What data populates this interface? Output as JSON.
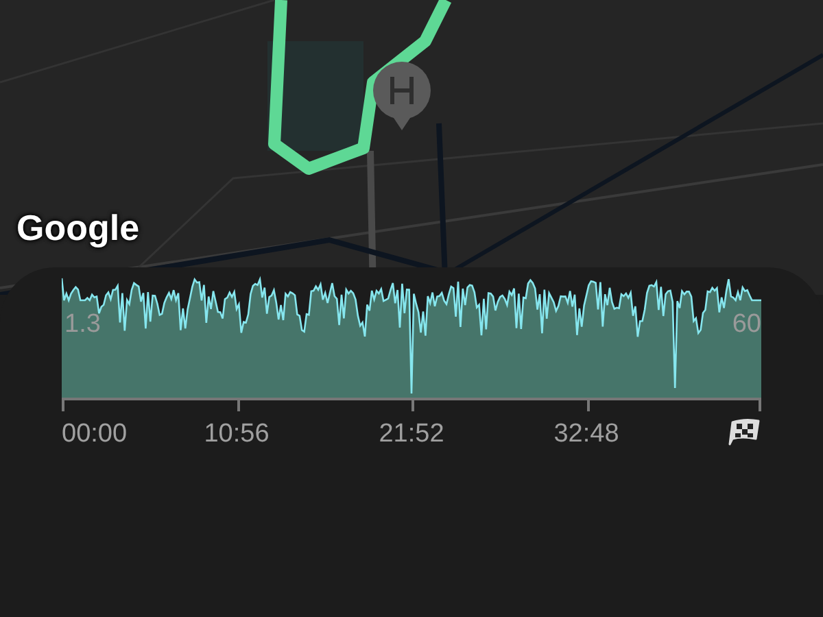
{
  "map": {
    "attribution": "Google"
  },
  "chart": {
    "left_label": "1.3",
    "right_label": "60",
    "x_labels": [
      "00:00",
      "10:56",
      "21:52",
      "32:48"
    ]
  }
}
